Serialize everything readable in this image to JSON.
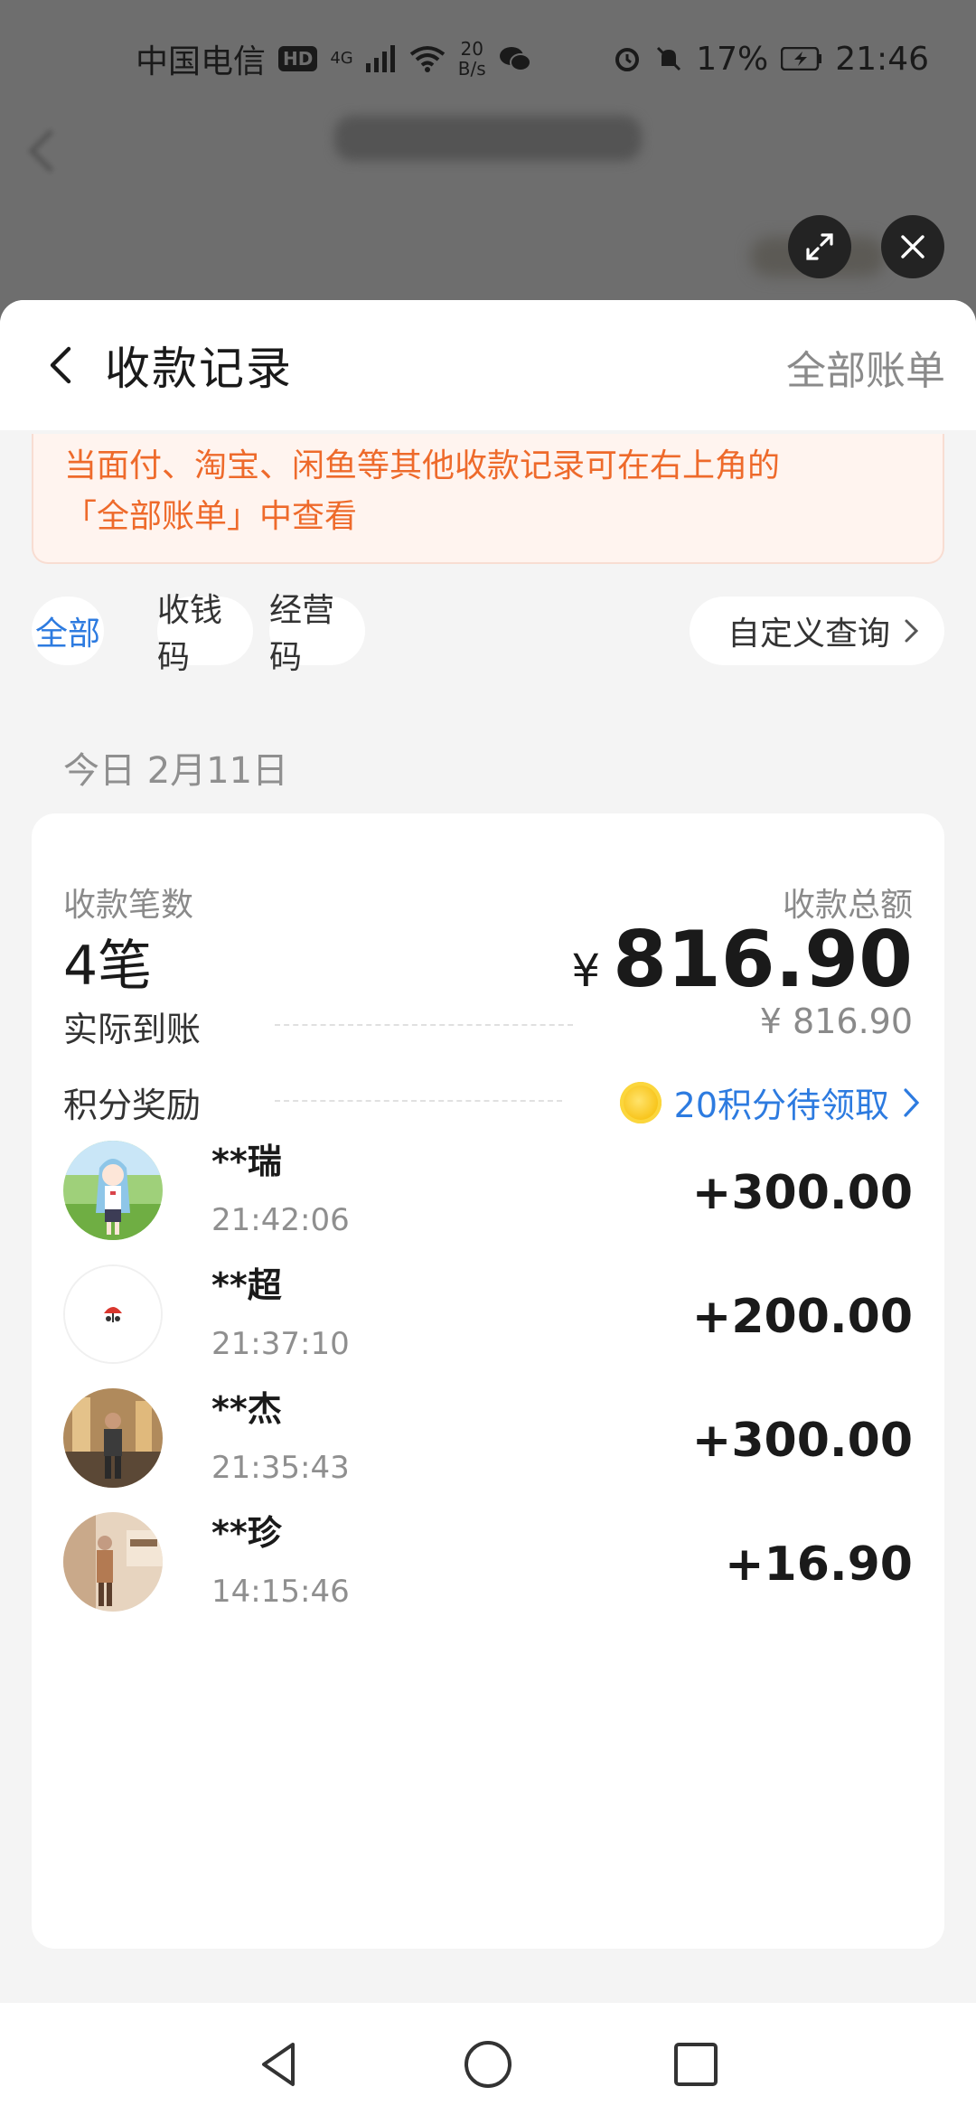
{
  "status_bar": {
    "carrier": "中国电信",
    "hd": "HD",
    "network": "4G",
    "speed_value": "20",
    "speed_unit": "B/s",
    "battery": "17%",
    "time": "21:46"
  },
  "header": {
    "title": "收款记录",
    "all_bills": "全部账单"
  },
  "notice": {
    "line1": "当面付、淘宝、闲鱼等其他收款记录可在右上角的",
    "line2": "「全部账单」中查看"
  },
  "filters": {
    "chips": [
      "全部",
      "收钱码",
      "经营码"
    ],
    "selected": "全部",
    "custom_query": "自定义查询"
  },
  "date_label": "今日 2月11日",
  "summary": {
    "count_label": "收款笔数",
    "count_value": "4笔",
    "total_label": "收款总额",
    "currency": "¥",
    "total_value": "816.90",
    "received_label": "实际到账",
    "received_value": "¥ 816.90",
    "points_label": "积分奖励",
    "points_value": "20积分待领取"
  },
  "transactions": [
    {
      "name": "**瑞",
      "time": "21:42:06",
      "amount": "+300.00"
    },
    {
      "name": "**超",
      "time": "21:37:10",
      "amount": "+200.00"
    },
    {
      "name": "**杰",
      "time": "21:35:43",
      "amount": "+300.00"
    },
    {
      "name": "**珍",
      "time": "14:15:46",
      "amount": "+16.90"
    }
  ],
  "colors": {
    "accent_blue": "#2d7be0",
    "notice_orange": "#ee6a2b",
    "notice_bg": "#fff4ef"
  }
}
